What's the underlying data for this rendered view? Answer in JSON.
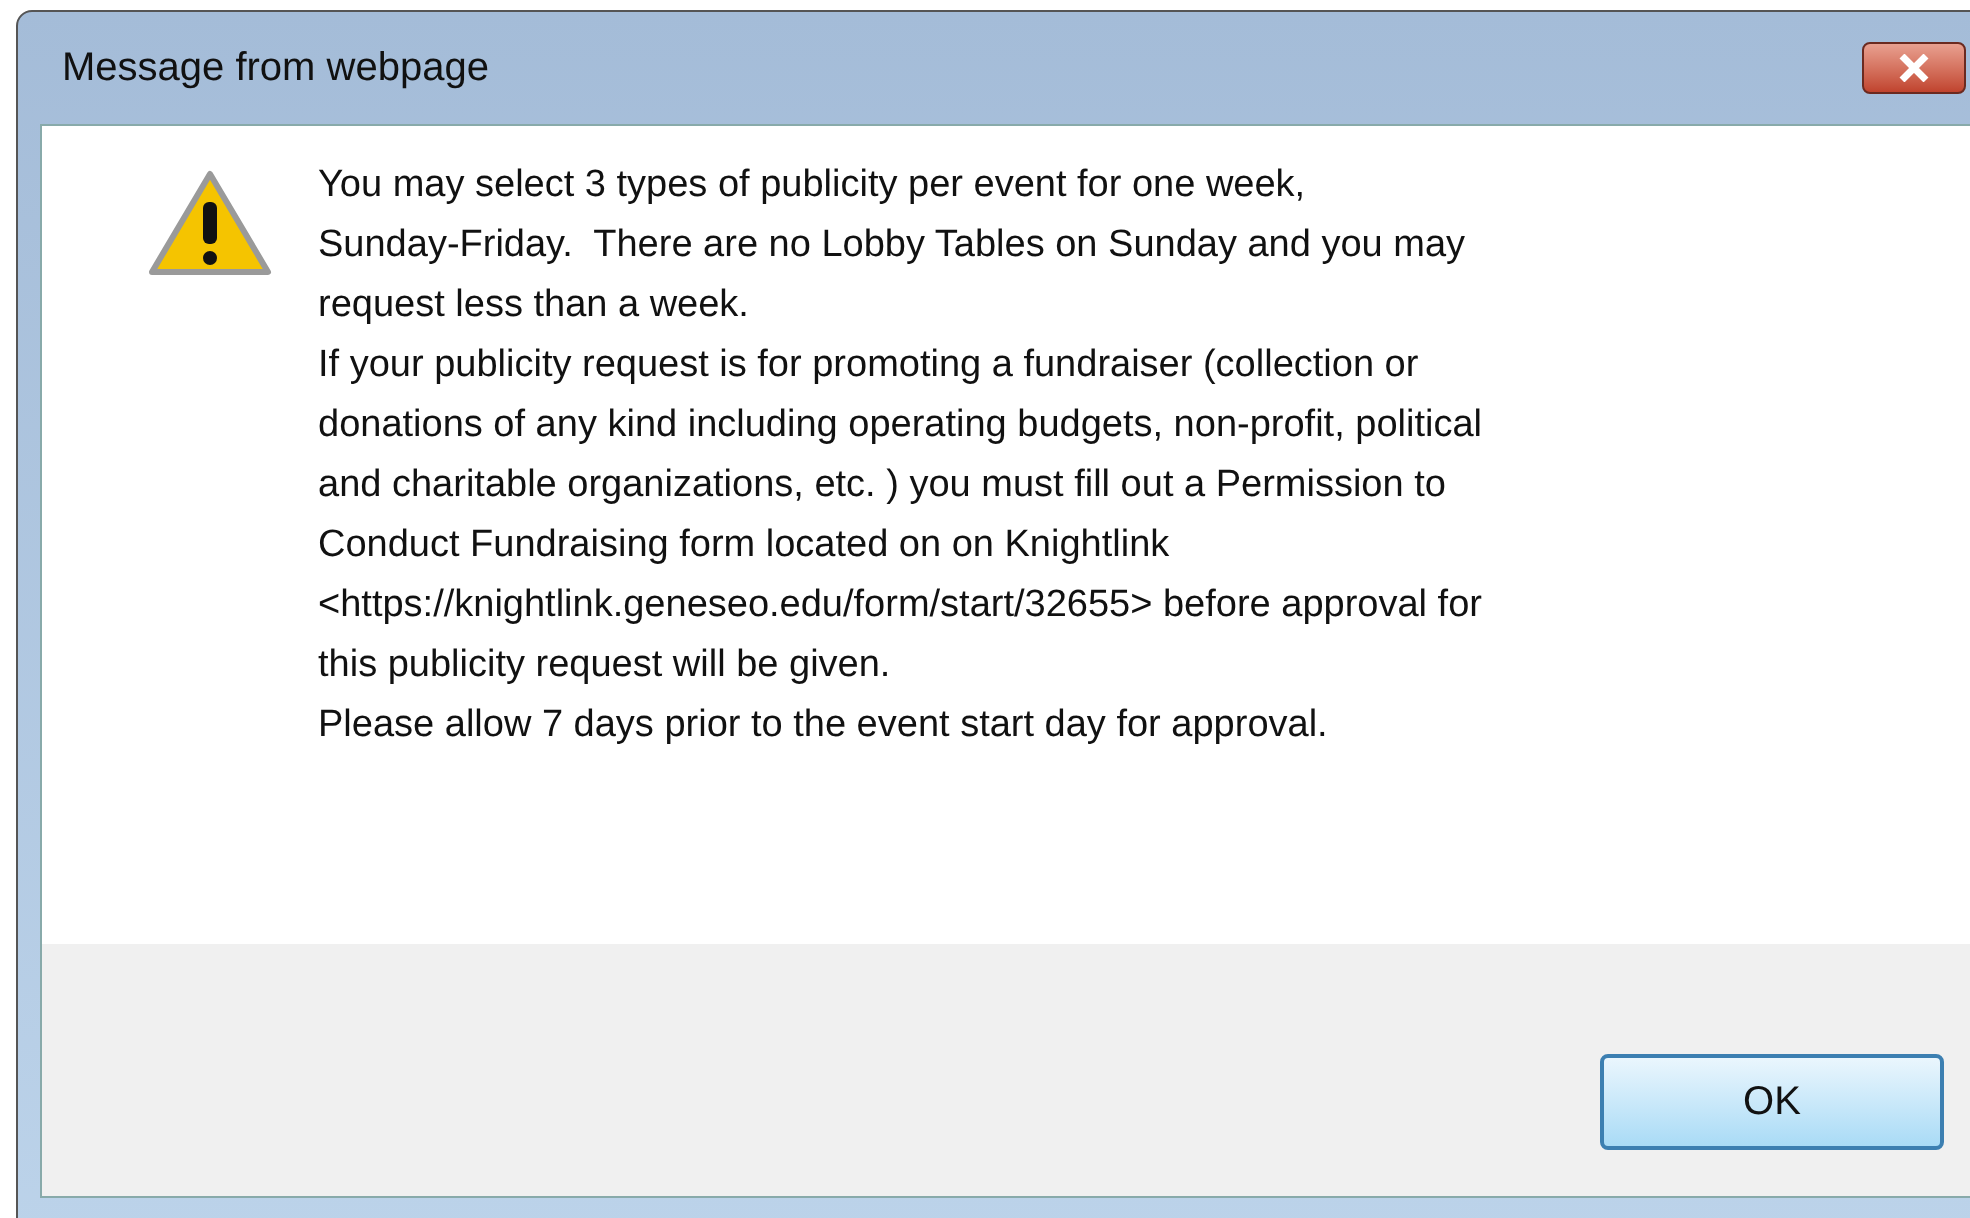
{
  "window": {
    "title": "Message from webpage"
  },
  "message_lines": [
    "You may select 3 types of publicity per event for one week,",
    "Sunday-Friday.  There are no Lobby Tables on Sunday and you may",
    "request less than a week.",
    "If your publicity request is for promoting a fundraiser (collection or",
    "donations of any kind including operating budgets, non-profit, political",
    "and charitable organizations, etc. ) you must fill out a Permission to",
    "Conduct Fundraising form located on on Knightlink",
    "<https://knightlink.geneseo.edu/form/start/32655> before approval for",
    "this publicity request will be given.",
    "Please allow 7 days prior to the event start day for approval."
  ],
  "buttons": [
    "OK"
  ]
}
